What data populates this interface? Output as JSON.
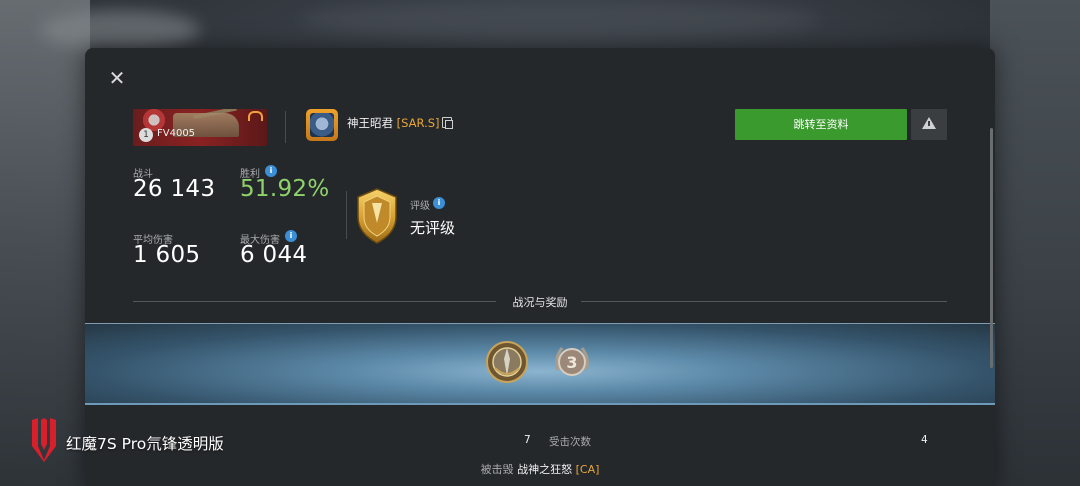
{
  "tank": {
    "tier": "1",
    "name": "FV4005"
  },
  "player": {
    "name": "神王昭君",
    "clan": "[SAR.S]"
  },
  "buttons": {
    "profile": "跳转至资料"
  },
  "stats": {
    "battles_label": "战斗",
    "battles_value": "26 143",
    "winrate_label": "胜利",
    "winrate_value": "51.92%",
    "avgdmg_label": "平均伤害",
    "avgdmg_value": "1 605",
    "maxdmg_label": "最大伤害",
    "maxdmg_value": "6 044"
  },
  "rating": {
    "label": "评级",
    "value": "无评级"
  },
  "section": {
    "title": "战况与奖励"
  },
  "awards": [
    {
      "icon": "ace-medal-icon"
    },
    {
      "icon": "third-class-medal-icon",
      "number": "3"
    }
  ],
  "battle": {
    "left_value": "7",
    "hits_received_label": "受击次数",
    "hits_received_value": "4",
    "killed_by_label": "被击毁",
    "killer_name": "战神之狂怒",
    "killer_clan": "[CA]"
  },
  "watermark": {
    "text": "红魔7S Pro氘锋透明版"
  },
  "colors": {
    "accent_green": "#3a9a2e",
    "winrate_green": "#8fd26b",
    "clan_orange": "#e8a63a",
    "info_blue": "#3a8fd6"
  }
}
